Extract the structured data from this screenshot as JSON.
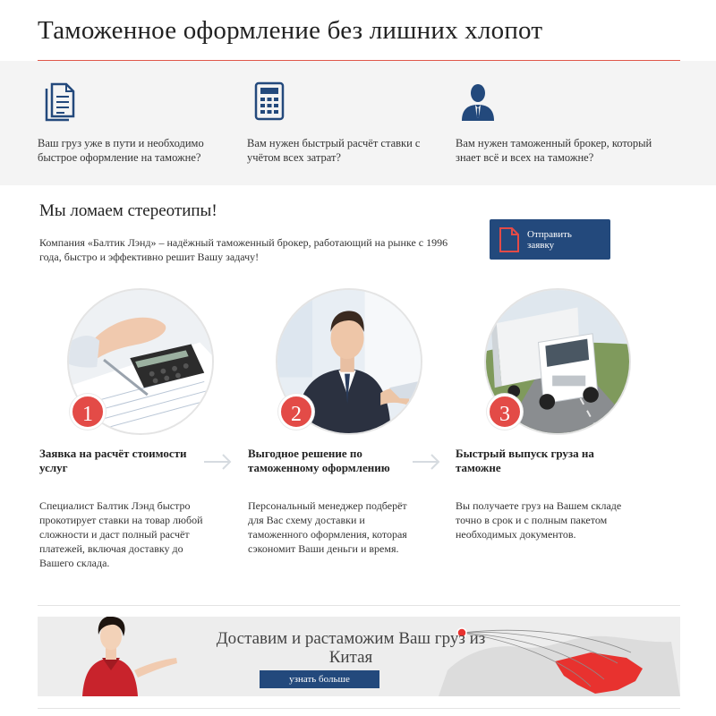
{
  "page": {
    "title": "Таможенное оформление без лишних хлопот"
  },
  "features": [
    {
      "icon": "document-icon",
      "text": "Ваш груз уже в пути и необходимо быстрое оформление на таможне?"
    },
    {
      "icon": "calculator-icon",
      "text": "Вам нужен быстрый расчёт ставки с учётом всех затрат?"
    },
    {
      "icon": "broker-person-icon",
      "text": "Вам нужен таможенный брокер, который знает всё и всех на таможне?"
    }
  ],
  "cta": {
    "heading": "Мы ломаем стереотипы!",
    "text": "Компания «Балтик Лэнд» – надёжный таможенный брокер, работающий на рынке с 1996 года, быстро и эффективно решит Вашу задачу!",
    "button_label": "Отправить заявку"
  },
  "steps": [
    {
      "number": "1",
      "title": "Заявка на расчёт стоимости услуг",
      "description": "Специалист Балтик Лэнд быстро прокотирует ставки на товар любой сложности и даст полный расчёт платежей, включая доставку до Вашего склада."
    },
    {
      "number": "2",
      "title": "Выгодное решение по таможенному оформлению",
      "description": "Персональный менеджер подберёт для Вас схему доставки и таможенного оформления, которая сэкономит Ваши деньги и время."
    },
    {
      "number": "3",
      "title": "Быстрый выпуск груза на таможне",
      "description": "Вы получаете груз на Вашем складе точно в срок и с полным пакетом необходимых документов."
    }
  ],
  "banner": {
    "title": "Доставим и растаможим Ваш груз из Китая",
    "button_label": "узнать больше"
  },
  "colors": {
    "accent_red": "#e34b47",
    "brand_blue": "#23497c",
    "rule_red": "#e0574a"
  }
}
